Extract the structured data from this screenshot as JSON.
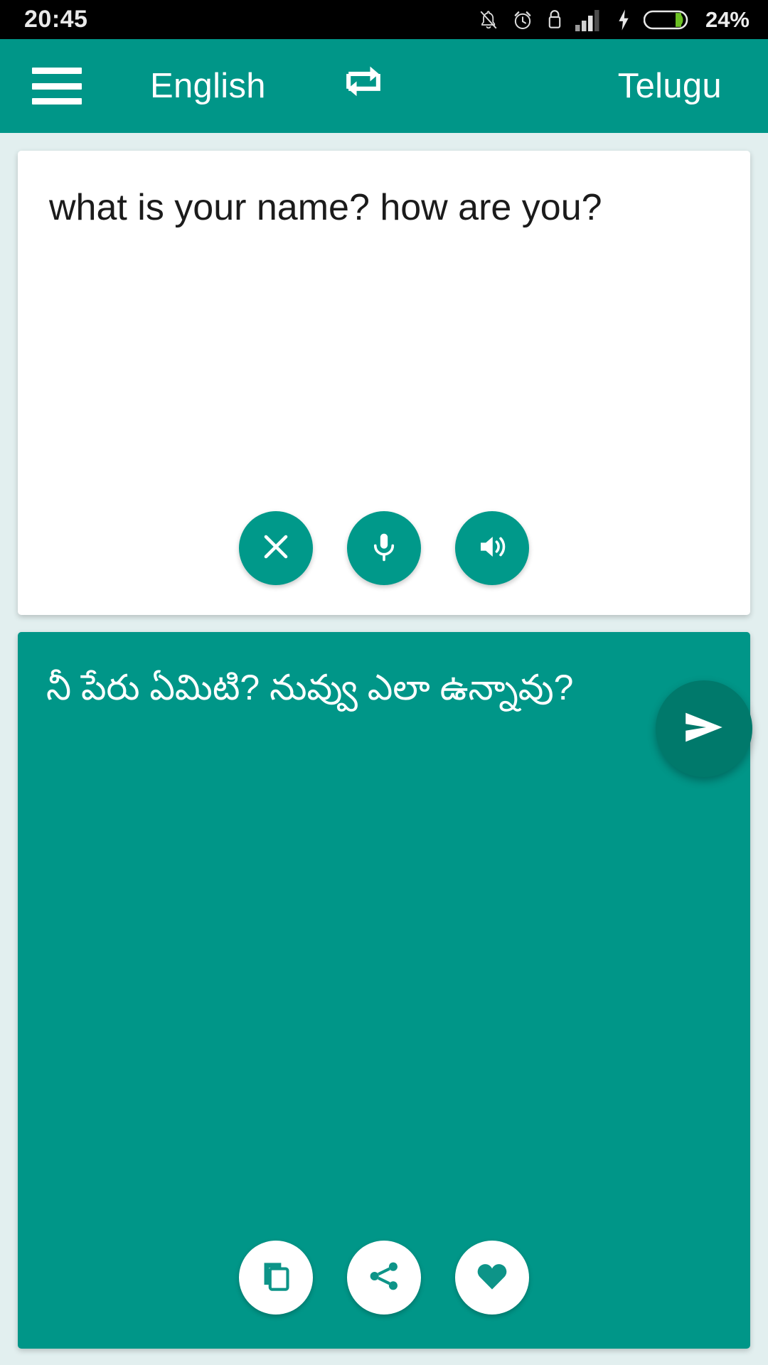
{
  "status_bar": {
    "time": "20:45",
    "battery_percent": "24%",
    "icons": [
      "bell-off-icon",
      "alarm-clock-icon",
      "usb-lock-icon",
      "signal-bars-icon",
      "charging-bolt-icon",
      "battery-icon"
    ],
    "battery_fill_color": "#6cc024",
    "background_color": "#000000"
  },
  "toolbar": {
    "menu_label": "menu-icon",
    "source_language": "English",
    "swap_label": "swap-languages-icon",
    "target_language": "Telugu",
    "background_color": "#009688"
  },
  "source_card": {
    "text": "what is your name? how are you?",
    "background_color": "#ffffff",
    "buttons": [
      {
        "name": "clear-button",
        "icon": "close-icon",
        "label": "Clear"
      },
      {
        "name": "mic-button",
        "icon": "microphone-icon",
        "label": "Speak"
      },
      {
        "name": "speak-source-button",
        "icon": "speaker-icon",
        "label": "Listen"
      }
    ]
  },
  "target_card": {
    "text": "నీ పేరు ఏమిటి? నువ్వు ఎలా ఉన్నావు?",
    "background_color": "#009688",
    "buttons": [
      {
        "name": "copy-button",
        "icon": "copy-icon",
        "label": "Copy"
      },
      {
        "name": "share-button",
        "icon": "share-icon",
        "label": "Share"
      },
      {
        "name": "favorite-button",
        "icon": "heart-icon",
        "label": "Favorite"
      }
    ]
  },
  "send_button": {
    "icon": "send-icon",
    "label": "Translate",
    "color": "#00796b"
  },
  "page": {
    "background_color": "#e2efef"
  }
}
